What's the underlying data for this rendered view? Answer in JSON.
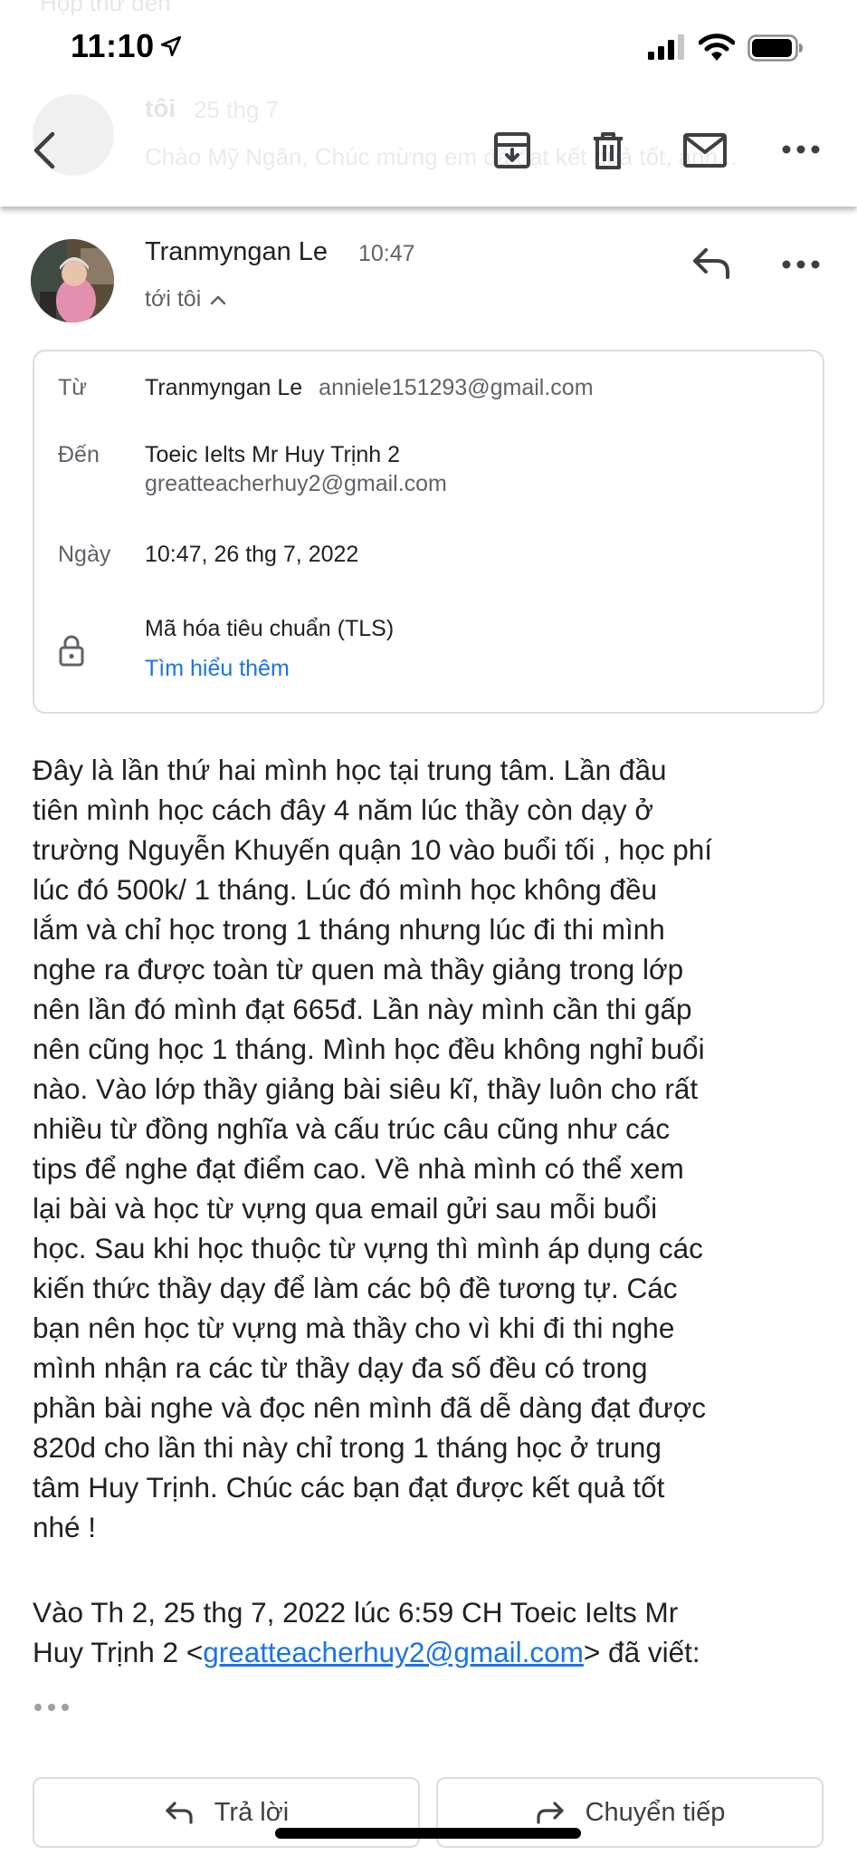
{
  "status_bar": {
    "time": "11:10"
  },
  "background_preview": {
    "folder_title": "Hộp thư đến",
    "from": "tôi",
    "date": "25 thg 7",
    "snippet": "Chào Mỹ Ngân, Chúc mừng em đã đạt kết quả tốt, anh..."
  },
  "toolbar": {
    "icons": [
      "back-icon",
      "archive-icon",
      "delete-icon",
      "mark-unread-icon",
      "more-icon"
    ]
  },
  "message": {
    "sender": "Tranmyngan Le",
    "time": "10:47",
    "to_line": "tới tôi"
  },
  "details": {
    "from_label": "Từ",
    "from_name": "Tranmyngan Le",
    "from_email": "anniele151293@gmail.com",
    "to_label": "Đến",
    "to_name": "Toeic Ielts Mr Huy Trịnh 2",
    "to_email": "greatteacherhuy2@gmail.com",
    "date_label": "Ngày",
    "date_value": "10:47, 26 thg 7, 2022",
    "security": "Mã hóa tiêu chuẩn (TLS)",
    "learn_more": "Tìm hiểu thêm"
  },
  "body": {
    "lines": [
      "Đây là lần thứ hai mình học tại trung tâm. Lần đầu",
      "tiên mình học cách đây 4 năm lúc thầy còn dạy ở",
      "trường Nguyễn Khuyến quận 10 vào buổi tối , học phí",
      "lúc đó 500k/ 1 tháng. Lúc đó mình học không đều",
      "lắm và chỉ học trong 1 tháng nhưng lúc đi thi mình",
      "nghe ra được toàn từ quen mà thầy giảng trong lớp",
      "nên lần đó mình đạt 665đ. Lần này mình cần thi gấp",
      "nên cũng học 1 tháng. Mình học đều không nghỉ buổi",
      "nào. Vào lớp thầy giảng bài siêu kĩ, thầy luôn cho rất",
      "nhiều từ đồng nghĩa và cấu trúc câu cũng như các",
      "tips để nghe đạt điểm cao. Về nhà mình có thể xem",
      "lại bài và học từ vựng qua email gửi sau mỗi buổi",
      "học. Sau khi học thuộc từ vựng thì mình áp dụng các",
      "kiến thức thầy dạy để làm các bộ đề tương tự. Các",
      "bạn nên học từ vựng mà thầy cho vì khi đi thi nghe",
      "mình nhận ra các từ thầy dạy đa số đều có trong",
      "phần bài nghe và đọc nên mình đã dễ dàng đạt được",
      "820d cho lần thi này chỉ trong 1 tháng học ở trung",
      "tâm Huy Trịnh. Chúc các bạn đạt được kết quả tốt",
      "nhé !"
    ],
    "quote_prefix_line1": "Vào Th 2, 25 thg 7, 2022 lúc 6:59 CH Toeic Ielts Mr",
    "quote_prefix_line2": "Huy Trịnh 2 <",
    "quote_email": "greatteacherhuy2@gmail.com",
    "quote_suffix": "> đã viết:"
  },
  "actions": {
    "reply": "Trả lời",
    "forward": "Chuyển tiếp"
  }
}
